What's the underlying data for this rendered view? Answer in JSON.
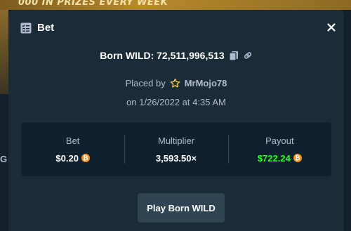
{
  "background": {
    "banner_text": "000 IN PRIZES EVERY WEEK",
    "left_letter": "G"
  },
  "modal": {
    "title": "Bet",
    "title_icon": "bet-slip-icon",
    "close_icon": "close-icon",
    "game_label": "Born WILD: 72,511,996,513",
    "copy_icon": "copy-icon",
    "link_icon": "link-icon",
    "placed_by_label": "Placed by",
    "user_icon": "star-icon",
    "username": "MrMojo78",
    "date": "on 1/26/2022 at 4:35 AM",
    "stats": {
      "bet_label": "Bet",
      "bet_value": "$0.20",
      "multiplier_label": "Multiplier",
      "multiplier_value": "3,593.50×",
      "payout_label": "Payout",
      "payout_value": "$722.24",
      "currency_icon": "bitcoin-icon",
      "currency_symbol": "₿"
    },
    "play_button_label": "Play Born WILD"
  },
  "colors": {
    "modal_bg": "#1a2c38",
    "stats_bg": "#0f212e",
    "muted_text": "#b1bad3",
    "payout_green": "#1fff20",
    "button_bg": "#2f4553",
    "star_yellow": "#f2c94c",
    "bitcoin_orange": "#f7931a"
  }
}
